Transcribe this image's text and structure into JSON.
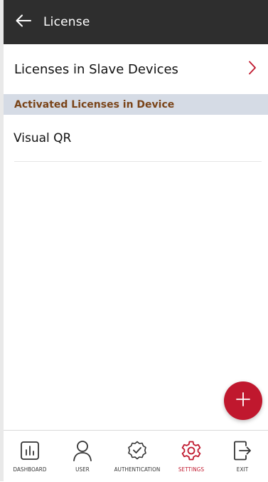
{
  "appbar": {
    "title": "License",
    "back_icon": "arrow-left-icon"
  },
  "slave_row": {
    "label": "Licenses in Slave Devices",
    "chevron_icon": "chevron-right-icon"
  },
  "section": {
    "header": "Activated Licenses in Device"
  },
  "licenses": [
    {
      "name": "Visual QR"
    }
  ],
  "fab": {
    "icon": "plus-icon"
  },
  "nav": {
    "items": [
      {
        "label": "DASHBOARD",
        "icon": "dashboard-icon",
        "active": false
      },
      {
        "label": "USER",
        "icon": "user-icon",
        "active": false
      },
      {
        "label": "AUTHENTICATION",
        "icon": "authentication-icon",
        "active": false
      },
      {
        "label": "SETTINGS",
        "icon": "settings-icon",
        "active": true
      },
      {
        "label": "EXIT",
        "icon": "exit-icon",
        "active": false
      }
    ]
  },
  "colors": {
    "accent": "#c0182e",
    "appbar_bg": "#2e2e2e",
    "section_bg": "#d5dbe5",
    "section_text": "#7a4419"
  }
}
